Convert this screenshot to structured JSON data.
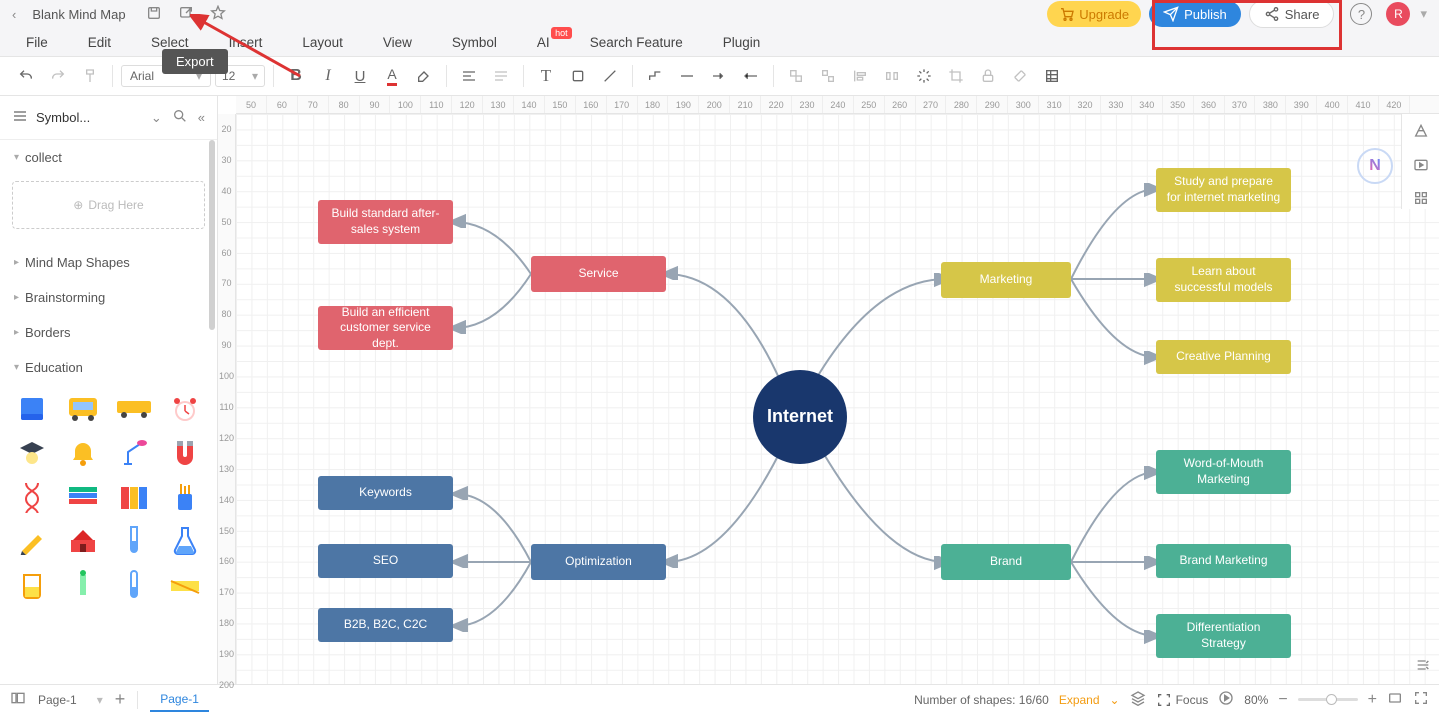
{
  "header": {
    "doc_title": "Blank Mind Map",
    "upgrade": "Upgrade",
    "publish": "Publish",
    "share": "Share",
    "avatar": "R"
  },
  "menu": {
    "file": "File",
    "edit": "Edit",
    "select": "Select",
    "insert": "Insert",
    "layout": "Layout",
    "view": "View",
    "symbol": "Symbol",
    "ai": "AI",
    "ai_badge": "hot",
    "search": "Search Feature",
    "plugin": "Plugin"
  },
  "tooltip": {
    "export": "Export"
  },
  "toolbar": {
    "font": "Arial",
    "size": "12"
  },
  "sidebar": {
    "title": "Symbol...",
    "collect": "collect",
    "drag_here": "Drag Here",
    "cats": [
      "Mind Map Shapes",
      "Brainstorming",
      "Borders",
      "Education"
    ]
  },
  "ruler_h": [
    "50",
    "60",
    "70",
    "80",
    "90",
    "100",
    "110",
    "120",
    "130",
    "140",
    "150",
    "160",
    "170",
    "180",
    "190",
    "200",
    "210",
    "220",
    "230",
    "240",
    "250",
    "260",
    "270",
    "280",
    "290",
    "300",
    "310",
    "320",
    "330",
    "340",
    "350",
    "360",
    "370",
    "380",
    "390",
    "400",
    "410",
    "420"
  ],
  "ruler_v": [
    "20",
    "30",
    "40",
    "50",
    "60",
    "70",
    "80",
    "90",
    "100",
    "110",
    "120",
    "130",
    "140",
    "150",
    "160",
    "170",
    "180",
    "190",
    "200"
  ],
  "nodes": {
    "center": "Internet",
    "service": "Service",
    "service_c1": "Build standard after-sales system",
    "service_c2": "Build an efficient customer service dept.",
    "marketing": "Marketing",
    "marketing_c1": "Study and prepare for internet marketing",
    "marketing_c2": "Learn about successful models",
    "marketing_c3": "Creative Planning",
    "optimization": "Optimization",
    "opt_c1": "Keywords",
    "opt_c2": "SEO",
    "opt_c3": "B2B, B2C, C2C",
    "brand": "Brand",
    "brand_c1": "Word-of-Mouth Marketing",
    "brand_c2": "Brand Marketing",
    "brand_c3": "Differentiation Strategy"
  },
  "status": {
    "page_sel": "Page-1",
    "page_tab": "Page-1",
    "shapes_count": "Number of shapes: 16/60",
    "expand": "Expand",
    "focus": "Focus",
    "zoom": "80%"
  },
  "chart_data": {
    "type": "mindmap",
    "title": "Internet",
    "root": {
      "label": "Internet",
      "children": [
        {
          "label": "Service",
          "color": "#e0646e",
          "children": [
            {
              "label": "Build standard after-sales system"
            },
            {
              "label": "Build an efficient customer service dept."
            }
          ]
        },
        {
          "label": "Marketing",
          "color": "#d6c648",
          "children": [
            {
              "label": "Study and prepare for internet marketing"
            },
            {
              "label": "Learn about successful models"
            },
            {
              "label": "Creative Planning"
            }
          ]
        },
        {
          "label": "Optimization",
          "color": "#4d76a5",
          "children": [
            {
              "label": "Keywords"
            },
            {
              "label": "SEO"
            },
            {
              "label": "B2B, B2C, C2C"
            }
          ]
        },
        {
          "label": "Brand",
          "color": "#4cb095",
          "children": [
            {
              "label": "Word-of-Mouth Marketing"
            },
            {
              "label": "Brand Marketing"
            },
            {
              "label": "Differentiation Strategy"
            }
          ]
        }
      ]
    }
  }
}
